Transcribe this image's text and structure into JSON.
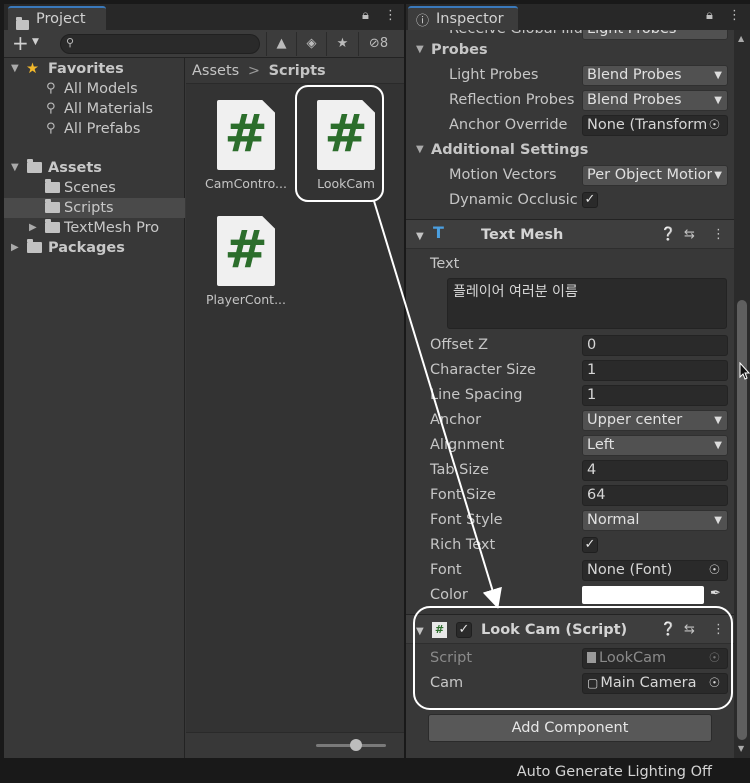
{
  "project": {
    "tab_title": "Project",
    "hidden_count": "8",
    "favorites": {
      "label": "Favorites",
      "items": [
        "All Models",
        "All Materials",
        "All Prefabs"
      ]
    },
    "assets": {
      "label": "Assets",
      "items": [
        "Scenes",
        "Scripts",
        "TextMesh Pro"
      ]
    },
    "packages_label": "Packages",
    "breadcrumb": {
      "root": "Assets",
      "separator": ">",
      "current": "Scripts"
    },
    "files": [
      {
        "glyph": "#",
        "label": "CamContro..."
      },
      {
        "glyph": "#",
        "label": "LookCam"
      },
      {
        "glyph": "#",
        "label": "PlayerCont..."
      }
    ]
  },
  "inspector": {
    "tab_title": "Inspector",
    "cutoff_row": {
      "label": "Receive Global Illum",
      "value": "Light Probes"
    },
    "probes": {
      "label": "Probes",
      "light_probes": {
        "label": "Light Probes",
        "value": "Blend Probes"
      },
      "reflection_probes": {
        "label": "Reflection Probes",
        "value": "Blend Probes"
      },
      "anchor_override": {
        "label": "Anchor Override",
        "value": "None (Transform"
      }
    },
    "additional": {
      "label": "Additional Settings",
      "motion_vectors": {
        "label": "Motion Vectors",
        "value": "Per Object Motion"
      },
      "dynamic_occlusion": {
        "label": "Dynamic Occlusic",
        "checked": true
      }
    },
    "text_mesh": {
      "title": "Text Mesh",
      "text_label": "Text",
      "text_value": "플레이어 여러분 이름",
      "fields": [
        {
          "label": "Offset Z",
          "value": "0",
          "kind": "text"
        },
        {
          "label": "Character Size",
          "value": "1",
          "kind": "text"
        },
        {
          "label": "Line Spacing",
          "value": "1",
          "kind": "text"
        },
        {
          "label": "Anchor",
          "value": "Upper center",
          "kind": "dropdown"
        },
        {
          "label": "Alignment",
          "value": "Left",
          "kind": "dropdown"
        },
        {
          "label": "Tab Size",
          "value": "4",
          "kind": "text"
        },
        {
          "label": "Font Size",
          "value": "64",
          "kind": "text"
        },
        {
          "label": "Font Style",
          "value": "Normal",
          "kind": "dropdown"
        }
      ],
      "rich_text": {
        "label": "Rich Text",
        "checked": true
      },
      "font": {
        "label": "Font",
        "value": "None (Font)"
      },
      "color": {
        "label": "Color",
        "value": "#ffffff"
      }
    },
    "look_cam": {
      "title": "Look Cam (Script)",
      "script": {
        "label": "Script",
        "value": "LookCam"
      },
      "cam": {
        "label": "Cam",
        "value": "Main Camera"
      }
    },
    "add_component": "Add Component"
  },
  "status": {
    "text": "Auto Generate Lighting Off"
  },
  "colors": {
    "accent": "#3a79bb",
    "script_icon": "#2c6e2c",
    "annotation": "#ffffff"
  }
}
